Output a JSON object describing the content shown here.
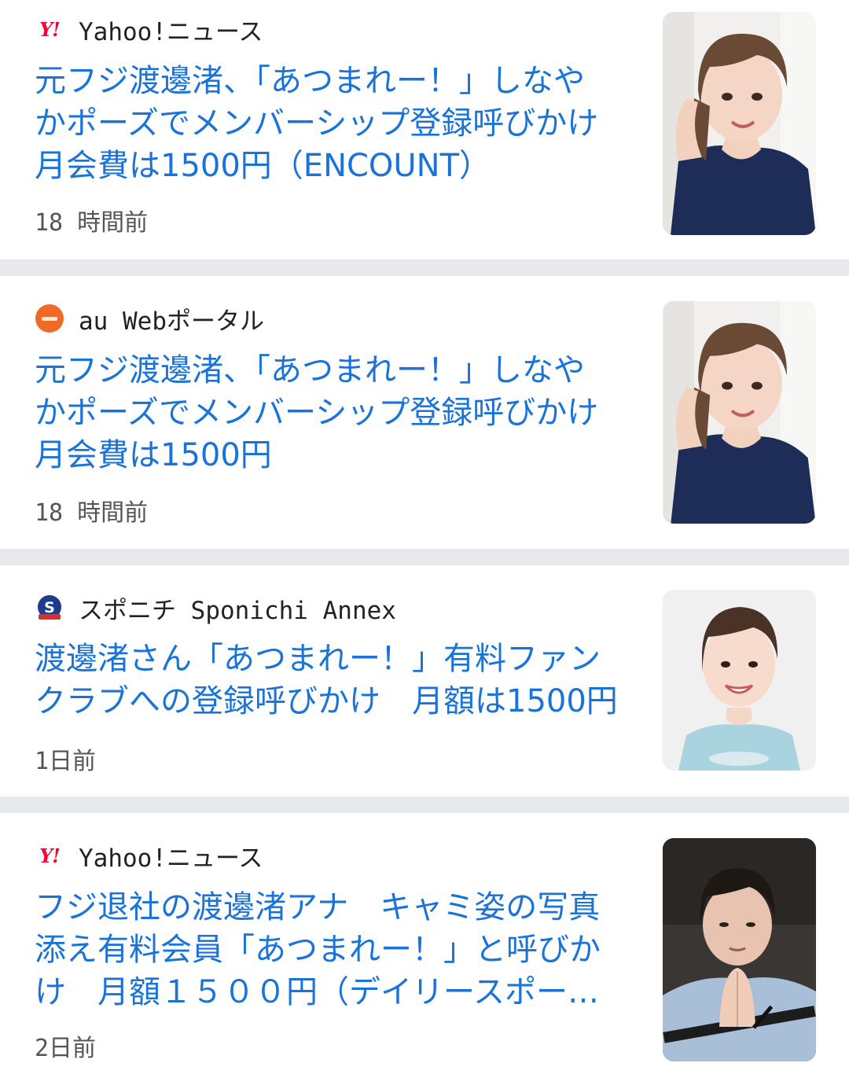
{
  "articles": [
    {
      "source": "Yahoo!ニュース",
      "source_icon": "yahoo-logo-icon",
      "source_icon_text": "Y!",
      "headline": "元フジ渡邊渚、「あつまれー！」しなや\nかポーズでメンバーシップ登録呼びかけ\n月会費は1500円（ENCOUNT）",
      "time": "18 時間前",
      "thumbnail": "photo-woman-posing"
    },
    {
      "source": "au Webポータル",
      "source_icon": "au-web-portal-icon",
      "source_icon_text": "",
      "headline": "元フジ渡邊渚、「あつまれー！」しなや\nかポーズでメンバーシップ登録呼びかけ\n月会費は1500円",
      "time": "18 時間前",
      "thumbnail": "photo-woman-posing"
    },
    {
      "source": "スポニチ Sponichi Annex",
      "source_icon": "sponichi-logo-icon",
      "source_icon_text": "S",
      "headline": "渡邊渚さん「あつまれー！」有料ファン\nクラブへの登録呼びかけ　月額は1500円",
      "time": "1日前",
      "thumbnail": "photo-woman-smiling"
    },
    {
      "source": "Yahoo!ニュース",
      "source_icon": "yahoo-logo-icon",
      "source_icon_text": "Y!",
      "headline": "フジ退社の渡邊渚アナ　キャミ姿の写真\n添え有料会員「あつまれー！」と呼びか\nけ　月額１５００円（デイリースポー…",
      "time": "2日前",
      "thumbnail": "photo-woman-hands-clasped"
    }
  ],
  "colors": {
    "headline": "#1a73d9",
    "source_text": "#222222",
    "time_text": "#555555",
    "separator": "#e8e9ed",
    "yahoo_red": "#ff0033",
    "au_orange": "#f06a25",
    "sponichi_blue": "#1f3b8f"
  }
}
